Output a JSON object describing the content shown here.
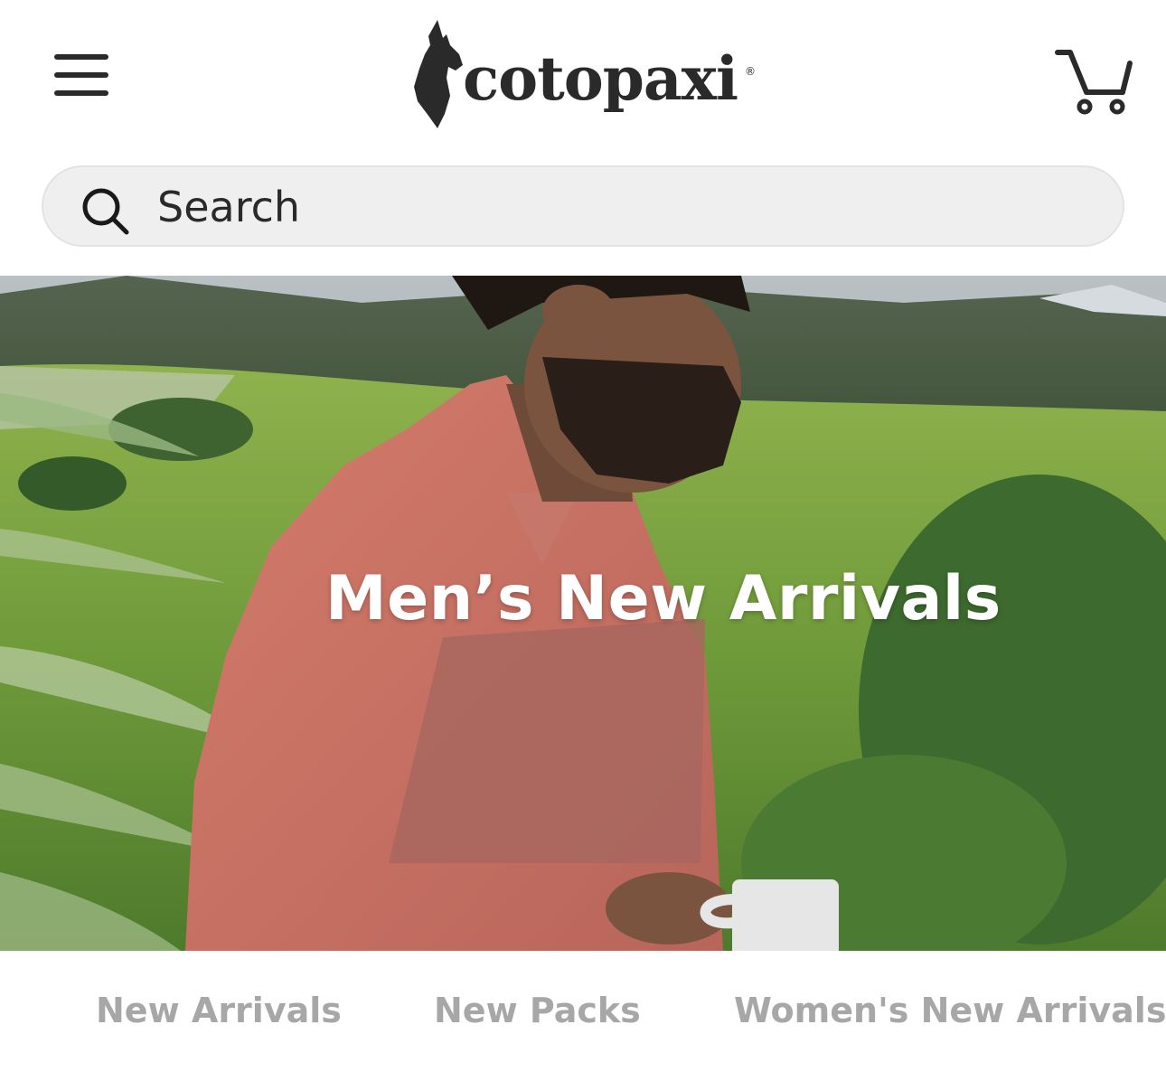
{
  "header": {
    "menu_icon": "hamburger-menu-icon",
    "logo": {
      "text": "cotopaxi",
      "registered_mark": "®",
      "mark_icon": "llama-logo-icon"
    },
    "cart_icon": "shopping-cart-icon"
  },
  "search": {
    "icon": "search-icon",
    "placeholder": "Search",
    "value": ""
  },
  "hero": {
    "title": "Men’s New Arrivals"
  },
  "category_tabs": [
    {
      "label": "New Arrivals"
    },
    {
      "label": "New Packs"
    },
    {
      "label": "Women's New Arrivals"
    }
  ],
  "colors": {
    "text_dark": "#2a2a2a",
    "search_bg": "#efefef",
    "tab_text": "#a7a7a7",
    "hero_title": "#ffffff"
  }
}
